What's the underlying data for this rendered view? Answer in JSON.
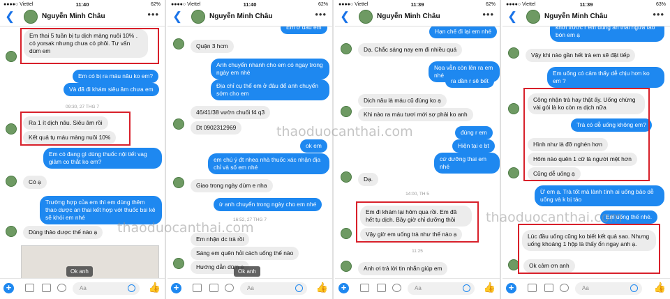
{
  "panels": [
    {
      "carrier": "●●●●○ Viettel",
      "time": "11:40",
      "battery": "62%",
      "name": "Nguyễn Minh Châu",
      "messages": [
        "Em thai 5 tuần bị tụ dịch màng nuôi 10% . có yorsak nhưng chưa có phôi. Tư vấn dùm em",
        "Em có bị ra máu nâu ko em?",
        "Và đã đi khám siêu âm chưa em",
        "09:30, 27 THG 7",
        "Ra 1 ít dịch nâu. Siêu âm rồi",
        "Kết quả tụ máu màng nuôi 10%",
        "Em có đang gì dùng thuốc nội tiết vag giảm co thắt ko em?",
        "Có ạ",
        "Trường hợp của em thì em dùng thêm thao dược an thai kết hợp với thuốc bsi kê sẽ khỏi em nhé",
        "Dùng thảo dược thế nào ạ"
      ],
      "ok": "Ok anh"
    },
    {
      "carrier": "●●●●○ Viettel",
      "time": "11:40",
      "battery": "62%",
      "name": "Nguyễn Minh Châu",
      "messages": [
        "Em ở đâu em",
        "Quận 3 hcm",
        "Anh chuyển nhanh cho em có ngay trong ngày em nhé",
        "Địa chỉ cụ thể em ở đâu để anh chuyển sớm cho em",
        "46/41/38 vườn chuối f4 q3",
        "Dt 0902312969",
        "ok em",
        "em chú ý đt nhea nhà thuốc xác nhận địa chỉ và số em nhé",
        "Giao trong ngày dùm e nha",
        "ừ anh chuyển trong ngày cho em nhé",
        "16:52, 27 THG 7",
        "Em nhận dc trà rồi",
        "Sáng em quên hỏi cách uống thế nào",
        "Hướng dẫn dùm e"
      ],
      "ok": "Ok anh"
    },
    {
      "carrier": "●●●●○ Viettel",
      "time": "11:39",
      "battery": "62%",
      "name": "Nguyễn Minh Châu",
      "messages": [
        "Hạn chế đi lại em nhé",
        "Dạ. Chắc sáng nay em đi nhiều quá",
        "Nọa vẫn còn lên ra em nhé",
        "ra dần r sẽ bết",
        "Dịch nâu là máu cũ đúng ko ạ",
        "Khi nào ra máu tươi mới sợ phải ko anh",
        "đúng r em",
        "Hiện tại e bt",
        "cứ dưỡng thai em nhé",
        "Dạ.",
        "14:00, TH 5",
        "Em đi khám lại hôm qua rồi. Em đã hết tụ dịch. Bây giờ chỉ dưỡng thôi",
        "Vậy giờ em uống trà như thế nào ạ",
        "11:25",
        "Anh ơi trả lời tin nhắn giúp em"
      ]
    },
    {
      "carrier": "●●●●○ Viettel",
      "time": "11:39",
      "battery": "63%",
      "name": "Nguyễn Minh Châu",
      "messages": [
        "khởi trước r em dùng an thai ngừa táo bón em ạ",
        "Vậy khi nào gần hết trà em sẽ đặt tiếp",
        "Em uống có cảm thấy dễ chịu hơn ko em ?",
        "Công nhận trà hay thật ấy. Uống chừng vài gói là ko còn ra dịch nữa",
        "Trà có dễ uống không em?",
        "Hình như là đỡ nghén hơn",
        "Hôm nào quên 1 cữ là người mệt hơn",
        "Cũng dễ uống ạ",
        "Ừ em ạ. Trà tốt mà lành tính ai uống bảo dễ uống và k bị táo",
        "Em uống thế nhé.",
        "Lúc đầu uống cũng ko biết kết quả sao. Nhưng uống khoảng 1 hộp là thấy ổn ngay anh ạ.",
        "Ok cảm ơn anh"
      ]
    }
  ],
  "composer": {
    "placeholder": "Aa"
  },
  "watermark": "thaoduocanthai.com"
}
